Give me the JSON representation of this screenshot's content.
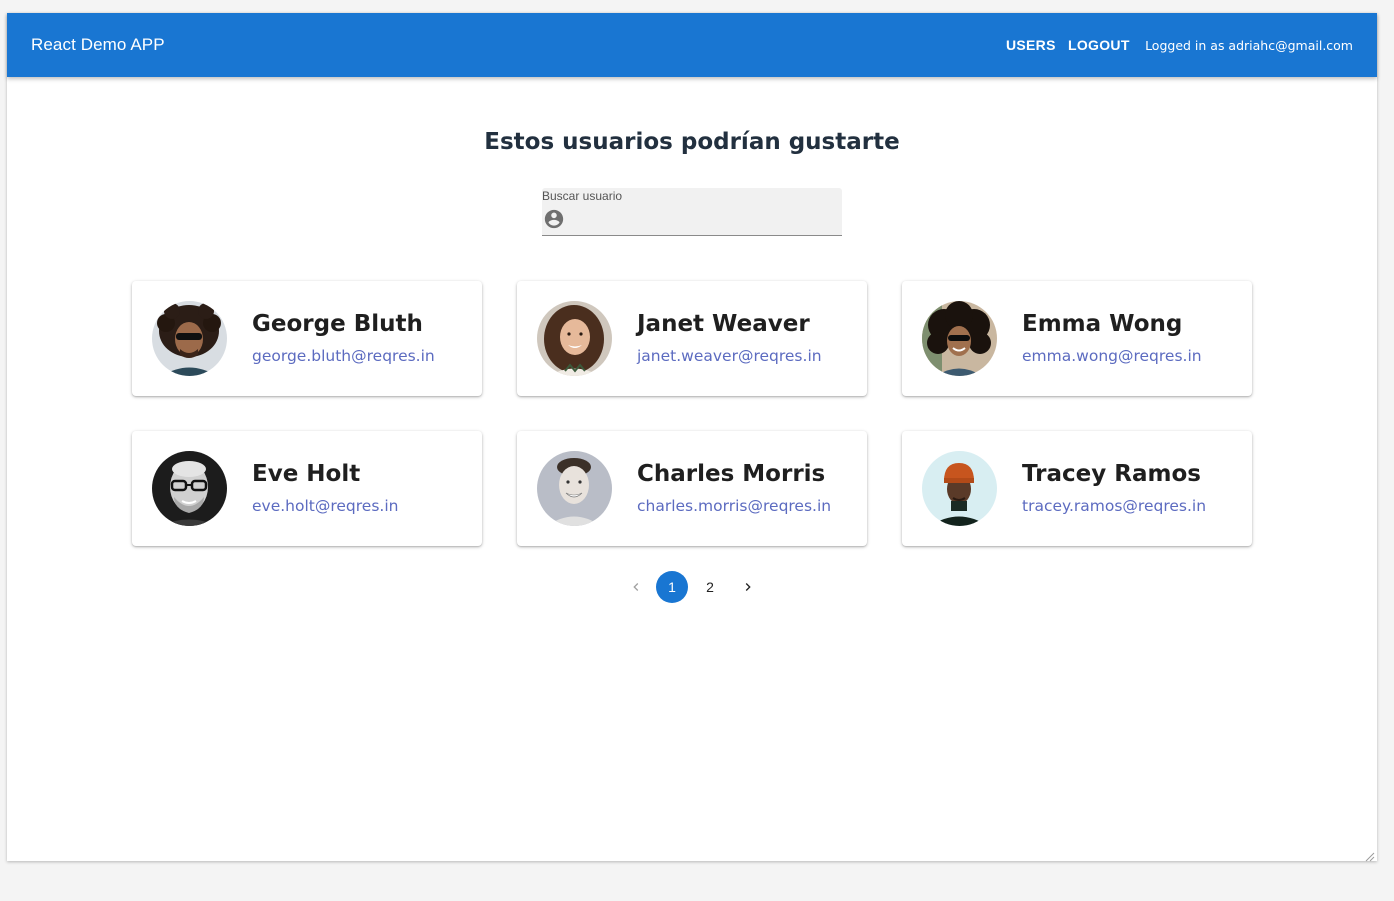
{
  "app": {
    "title": "React Demo APP",
    "nav": {
      "users": "USERS",
      "logout": "LOGOUT"
    },
    "logged_in_text": "Logged in as adriahc@gmail.com"
  },
  "main": {
    "heading": "Estos usuarios podrían gustarte",
    "search": {
      "label": "Buscar usuario",
      "value": "",
      "icon": "account-circle-icon"
    }
  },
  "users": [
    {
      "name": "George Bluth",
      "email": "george.bluth@reqres.in"
    },
    {
      "name": "Janet Weaver",
      "email": "janet.weaver@reqres.in"
    },
    {
      "name": "Emma Wong",
      "email": "emma.wong@reqres.in"
    },
    {
      "name": "Eve Holt",
      "email": "eve.holt@reqres.in"
    },
    {
      "name": "Charles Morris",
      "email": "charles.morris@reqres.in"
    },
    {
      "name": "Tracey Ramos",
      "email": "tracey.ramos@reqres.in"
    }
  ],
  "pagination": {
    "pages": [
      "1",
      "2"
    ],
    "current": "1",
    "prev_icon": "chevron-left-icon",
    "next_icon": "chevron-right-icon"
  },
  "colors": {
    "primary": "#1976d2",
    "email_link": "#5c6bc0",
    "heading": "#22303f"
  }
}
